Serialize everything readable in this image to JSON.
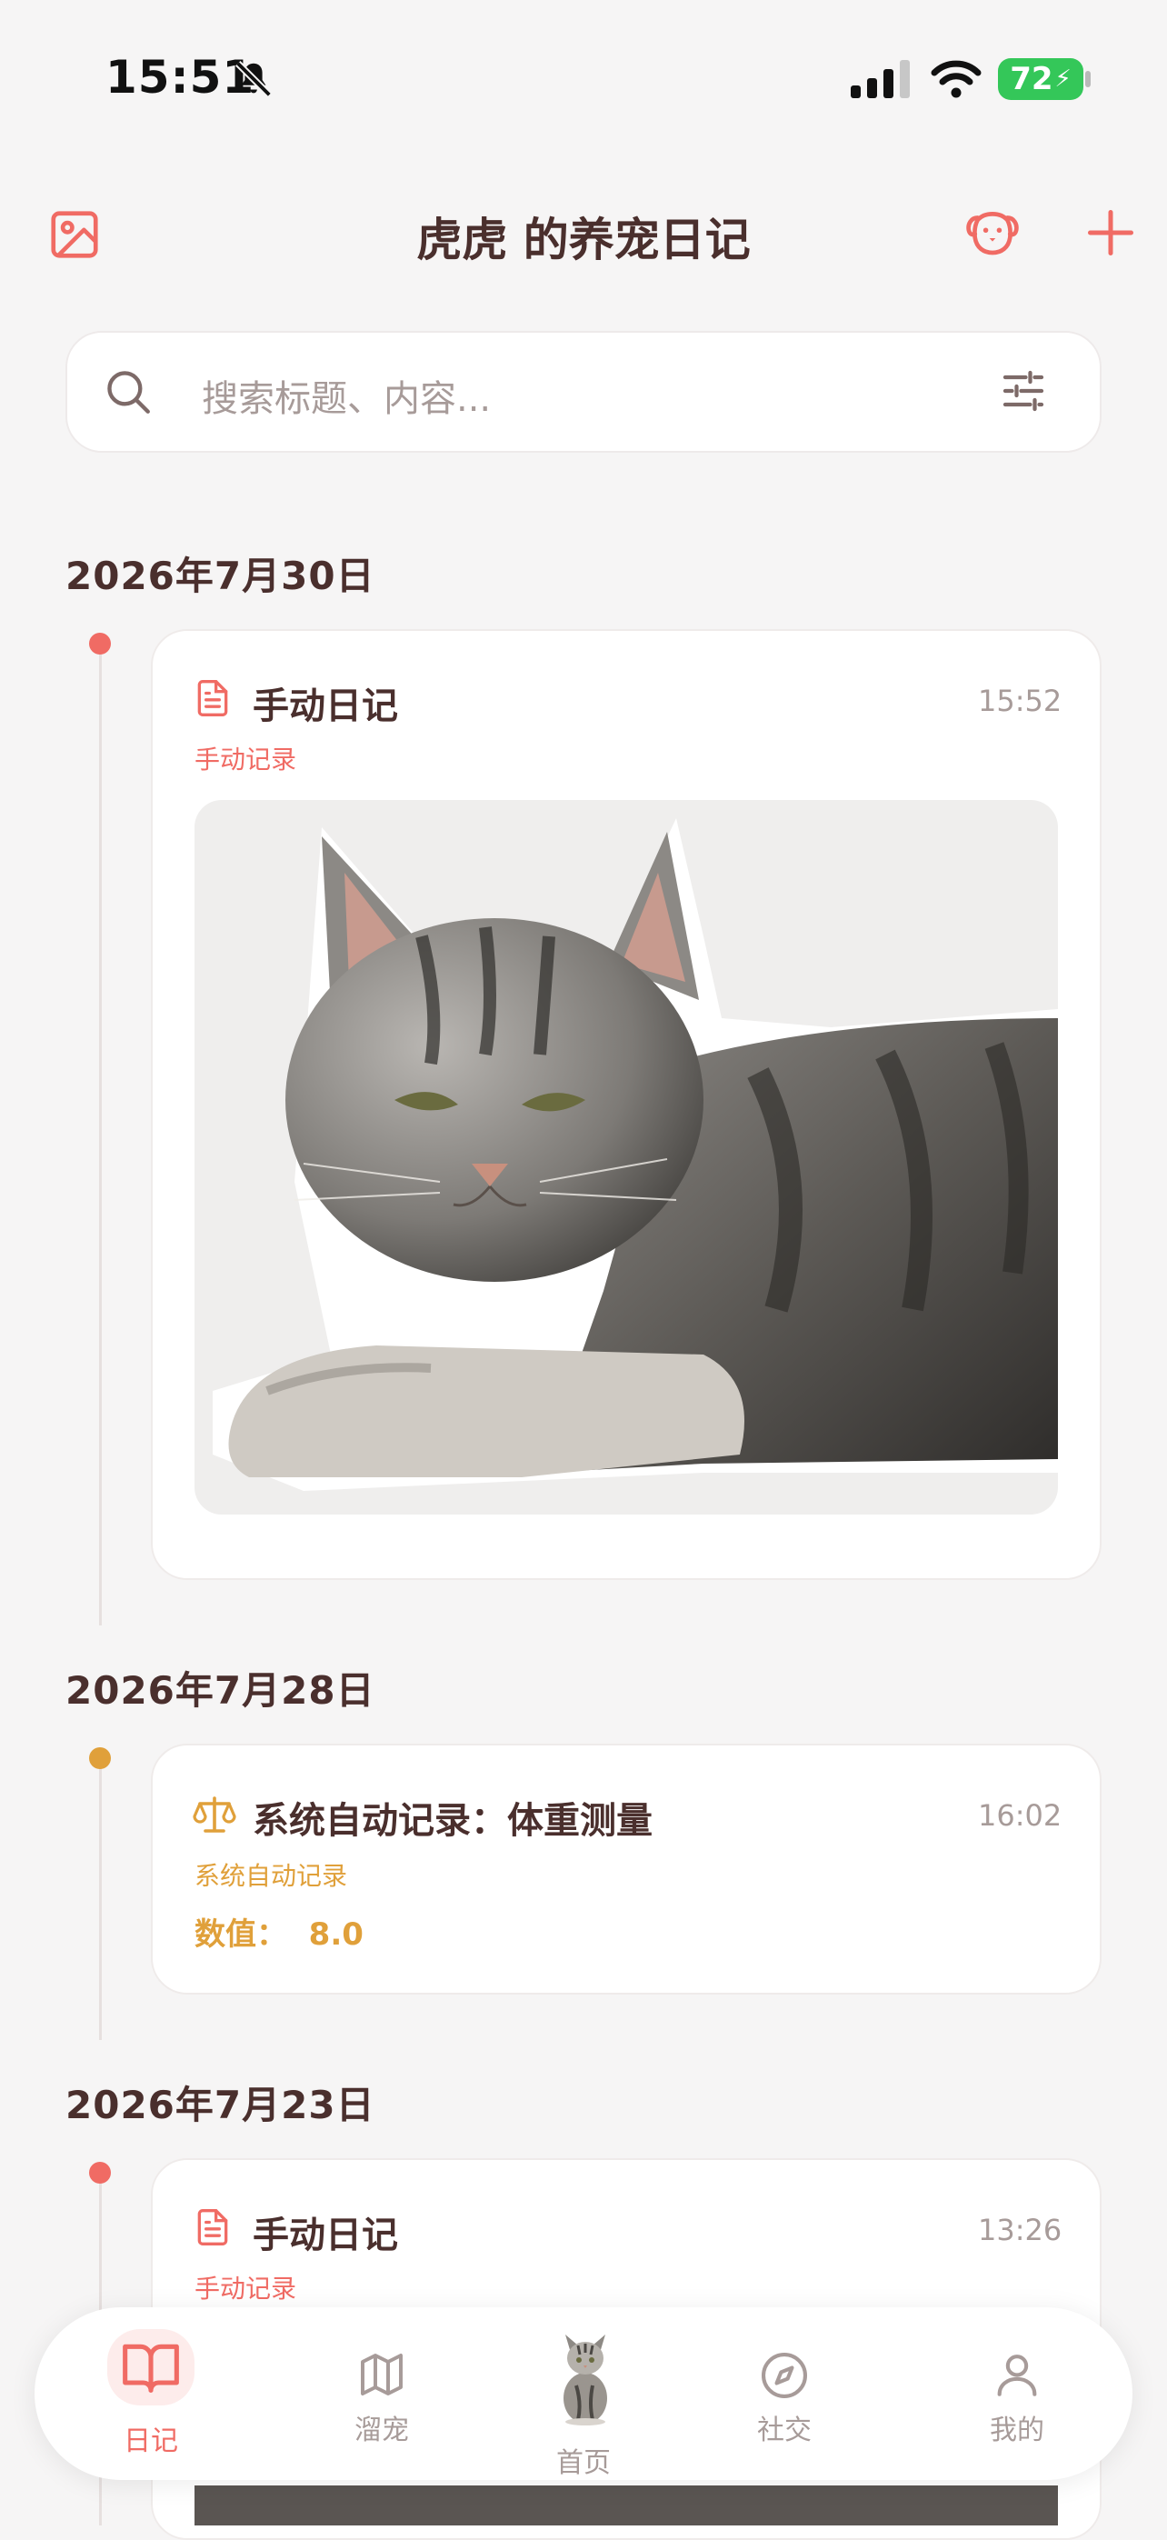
{
  "status_bar": {
    "time": "15:51",
    "battery": "72"
  },
  "header": {
    "title": "虎虎 的养宠日记"
  },
  "search": {
    "placeholder": "搜索标题、内容..."
  },
  "entries": [
    {
      "date": "2026年7月30日",
      "dot_color": "#f06b64",
      "title": "手动日记",
      "time": "15:52",
      "subtitle": "手动记录",
      "icon": "document-icon",
      "has_photo": true
    },
    {
      "date": "2026年7月28日",
      "dot_color": "#e0a03a",
      "title": "系统自动记录：体重测量",
      "time": "16:02",
      "subtitle": "系统自动记录",
      "value": "数值：  8.0",
      "icon": "scale-icon"
    },
    {
      "date": "2026年7月23日",
      "dot_color": "#f06b64",
      "title": "手动日记",
      "time": "13:26",
      "subtitle": "手动记录",
      "icon": "document-icon"
    }
  ],
  "tabs": [
    {
      "label": "日记",
      "icon": "book-icon",
      "active": true
    },
    {
      "label": "溜宠",
      "icon": "map-icon"
    },
    {
      "label": "首页",
      "icon": "cat-avatar"
    },
    {
      "label": "社交",
      "icon": "compass-icon"
    },
    {
      "label": "我的",
      "icon": "user-icon"
    }
  ],
  "colors": {
    "accent": "#f06b64",
    "auto": "#e0a03a",
    "text": "#4a2f2d",
    "muted": "#a79b99"
  }
}
